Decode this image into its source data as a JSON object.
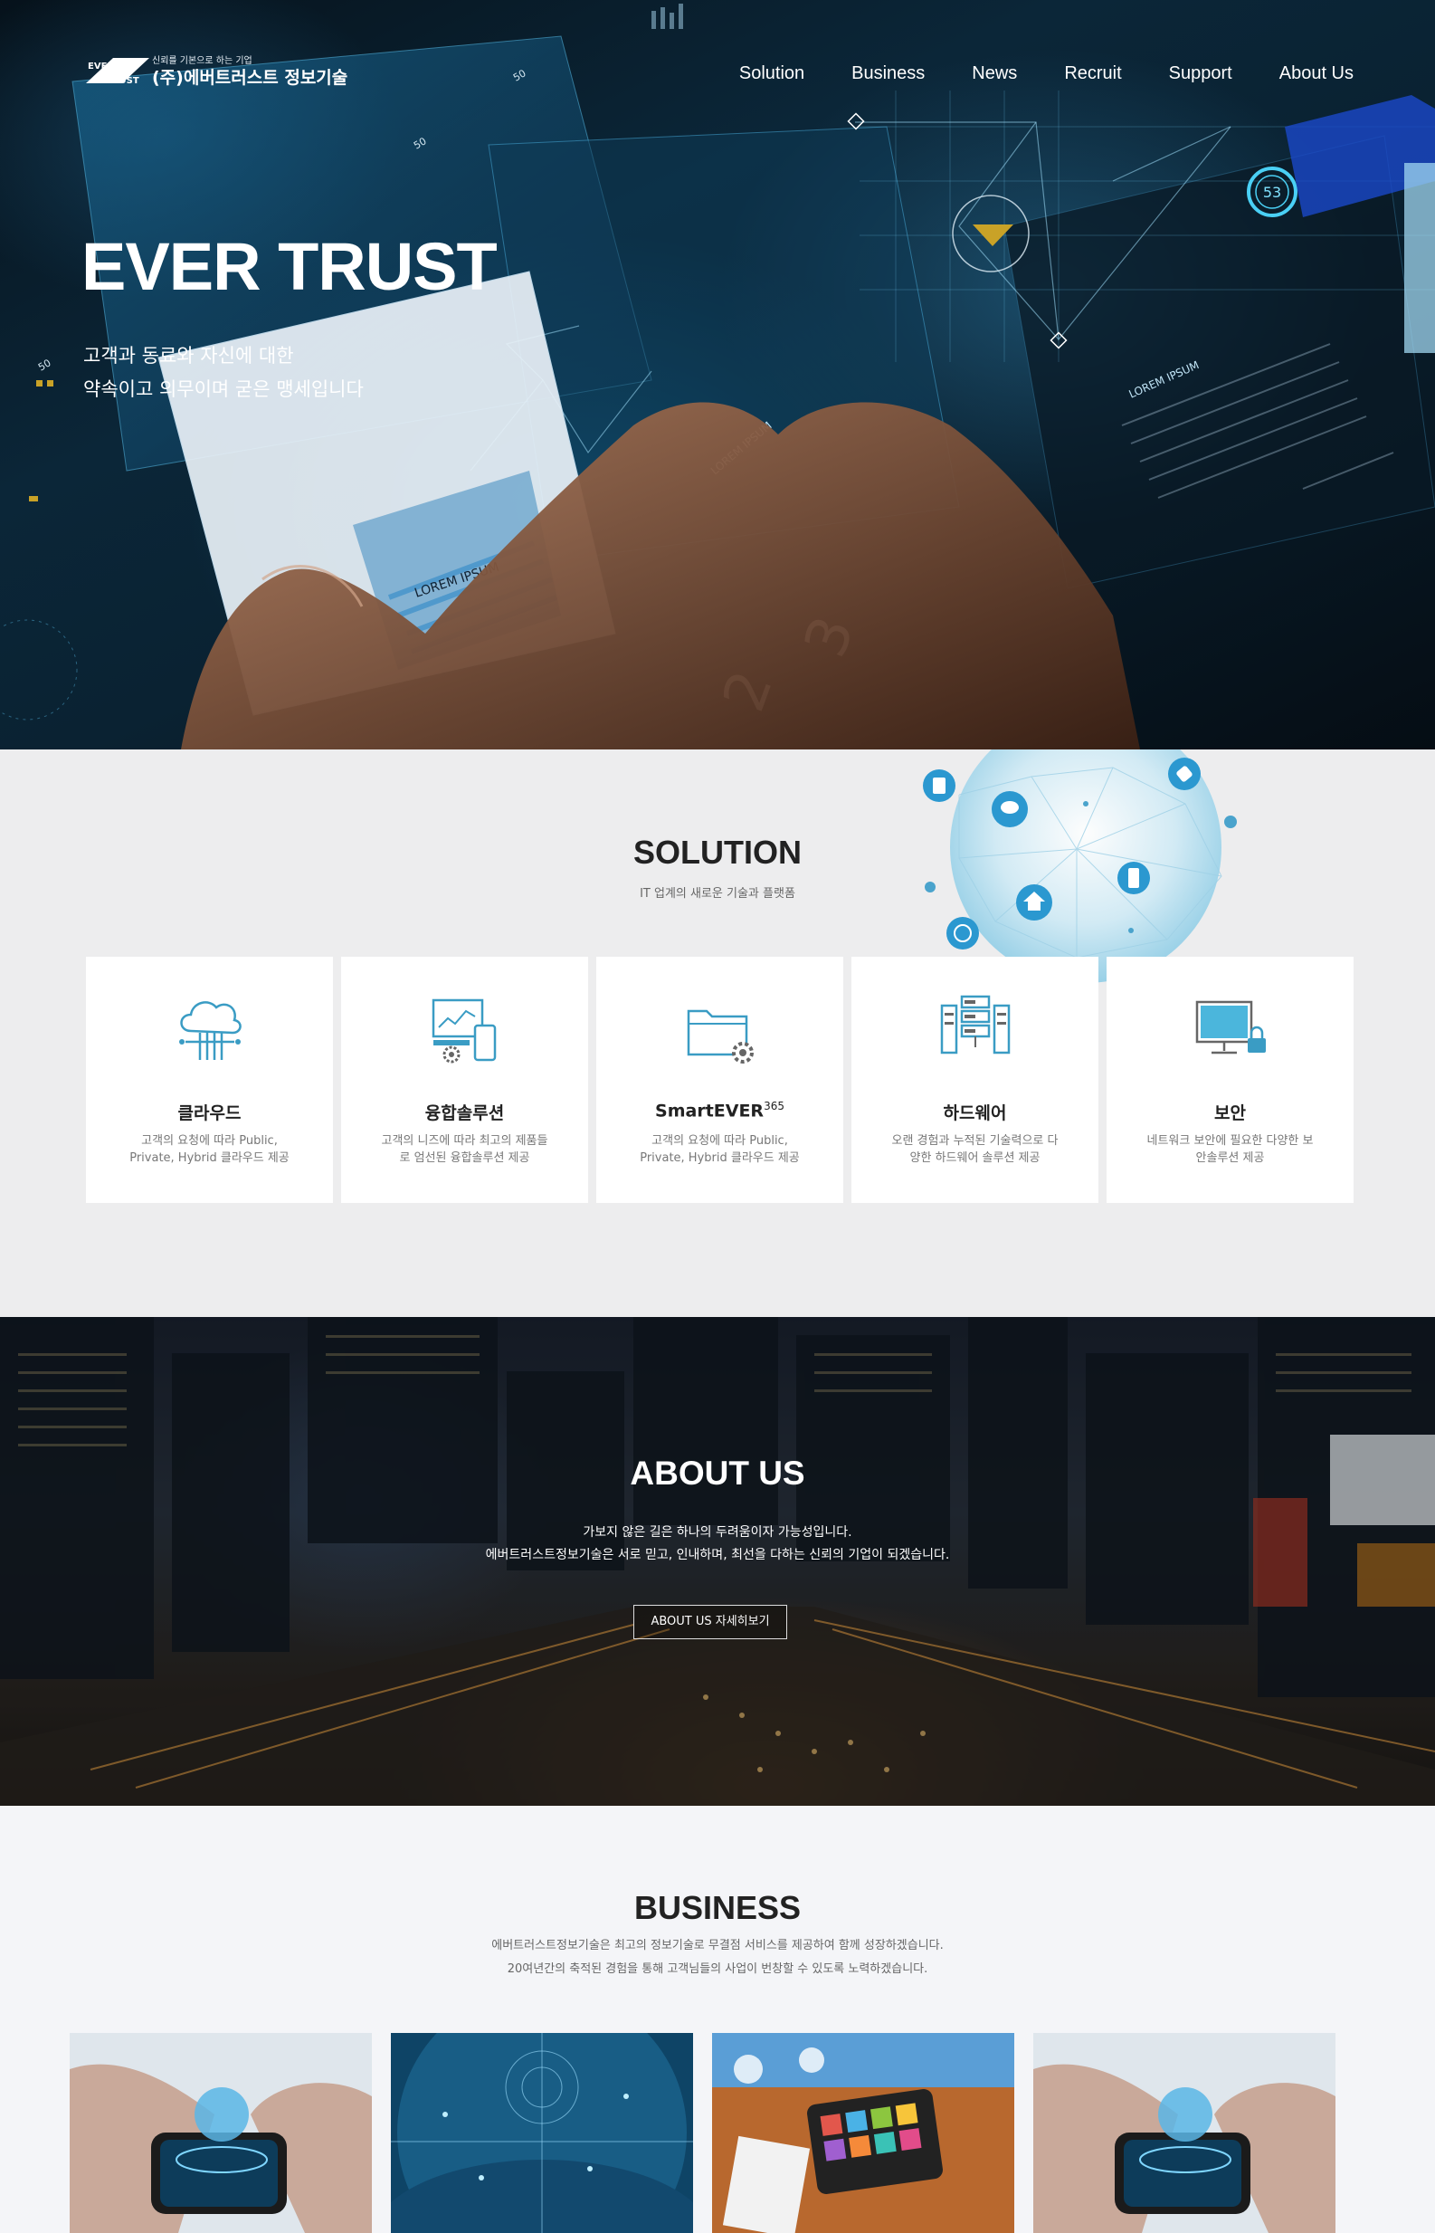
{
  "header": {
    "logo_mark_top": "EVER",
    "logo_mark_bottom": "TRUST",
    "logo_tagline": "신뢰를 기본으로 하는 기업",
    "logo_name": "(주)에버트러스트 정보기술",
    "nav": [
      "Solution",
      "Business",
      "News",
      "Recruit",
      "Support",
      "About Us"
    ]
  },
  "hero": {
    "title": "EVER TRUST",
    "subtitle_line1": "고객과 동료와 자신에 대한",
    "subtitle_line2": "약속이고 의무이며 굳은 맹세입니다",
    "art_text": [
      "LOREM IPSUM",
      "LOREM IPSUM",
      "2",
      "3",
      "53",
      "50",
      "50",
      "50"
    ]
  },
  "solution": {
    "title": "SOLUTION",
    "subtitle": "IT 업계의 새로운 기술과 플랫폼",
    "cards": [
      {
        "title": "클라우드",
        "sup": "",
        "desc": "고객의 요청에 따라 Public, Private, Hybrid 클라우드 제공",
        "icon": "cloud-icon"
      },
      {
        "title": "융합솔루션",
        "sup": "",
        "desc": "고객의 니즈에 따라 최고의 제품들로 엄선된 융합솔루션 제공",
        "icon": "devices-icon"
      },
      {
        "title": "SmartEVER",
        "sup": "365",
        "desc": "고객의 요청에 따라 Public, Private, Hybrid 클라우드 제공",
        "icon": "folder-gear-icon"
      },
      {
        "title": "하드웨어",
        "sup": "",
        "desc": "오랜 경험과 누적된 기술력으로 다양한 하드웨어 솔루션 제공",
        "icon": "server-icon"
      },
      {
        "title": "보안",
        "sup": "",
        "desc": "네트워크 보안에 필요한 다양한 보안솔루션 제공",
        "icon": "monitor-lock-icon"
      }
    ]
  },
  "about": {
    "title": "ABOUT US",
    "line1": "가보지 않은 길은 하나의 두려움이자 가능성입니다.",
    "line2": "에버트러스트정보기술은 서로 믿고, 인내하며, 최선을 다하는 신뢰의 기업이 되겠습니다.",
    "button": "ABOUT US 자세히보기"
  },
  "business": {
    "title": "BUSINESS",
    "line1": "에버트러스트정보기술은 최고의 정보기술로 무결점 서비스를 제공하여 함께 성장하겠습니다.",
    "line2": "20여년간의 축적된 경험을 통해 고객님들의 사업이 번창할 수 있도록 노력하겠습니다."
  },
  "colors": {
    "accent": "#48aed3",
    "icon_blue": "#3a9cc4",
    "gold": "#c9a227"
  }
}
